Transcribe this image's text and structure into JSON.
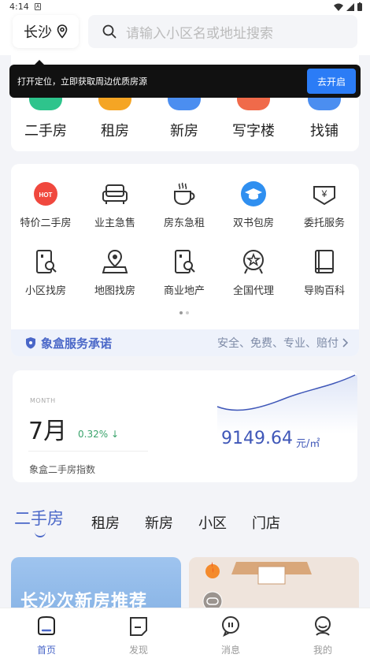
{
  "status_bar": {
    "time": "4:14"
  },
  "header": {
    "city": "长沙",
    "search_placeholder": "请输入小区名或地址搜索"
  },
  "location_tip": {
    "message": "打开定位，立即获取周边优质房源",
    "button": "去开启"
  },
  "categories": [
    {
      "label": "二手房",
      "icon": "house-icon",
      "color": "#2ec48c"
    },
    {
      "label": "租房",
      "icon": "rent-icon",
      "color": "#f5a524"
    },
    {
      "label": "新房",
      "icon": "new-house-icon",
      "color": "#4b8ef0"
    },
    {
      "label": "写字楼",
      "icon": "office-icon",
      "color": "#f06a4a"
    },
    {
      "label": "找铺",
      "icon": "shop-icon",
      "color": "#4b8ef0"
    }
  ],
  "services": [
    {
      "label": "特价二手房",
      "icon": "hot-icon"
    },
    {
      "label": "业主急售",
      "icon": "sofa-icon"
    },
    {
      "label": "房东急租",
      "icon": "cup-icon"
    },
    {
      "label": "双书包房",
      "icon": "graduation-cap-icon"
    },
    {
      "label": "委托服务",
      "icon": "yen-tag-icon"
    },
    {
      "label": "小区找房",
      "icon": "building-search-icon"
    },
    {
      "label": "地图找房",
      "icon": "map-pin-icon"
    },
    {
      "label": "商业地产",
      "icon": "commercial-search-icon"
    },
    {
      "label": "全国代理",
      "icon": "badge-star-icon"
    },
    {
      "label": "导购百科",
      "icon": "book-icon"
    }
  ],
  "promise": {
    "title": "象盒服务承诺",
    "subtitle": "安全、免费、专业、赔付"
  },
  "price_index": {
    "month_en": "MONTH",
    "month": "7月",
    "change": "0.32%",
    "price": "9149.64",
    "unit": "元/㎡",
    "name": "象盒二手房指数"
  },
  "feed_tabs": [
    "二手房",
    "租房",
    "新房",
    "小区",
    "门店"
  ],
  "feed": {
    "left_banner_text": "长沙次新房推荐"
  },
  "bottom_nav": [
    {
      "label": "首页",
      "icon": "home-icon",
      "active": true
    },
    {
      "label": "发现",
      "icon": "discover-icon",
      "active": false
    },
    {
      "label": "消息",
      "icon": "message-icon",
      "active": false
    },
    {
      "label": "我的",
      "icon": "profile-icon",
      "active": false
    }
  ]
}
